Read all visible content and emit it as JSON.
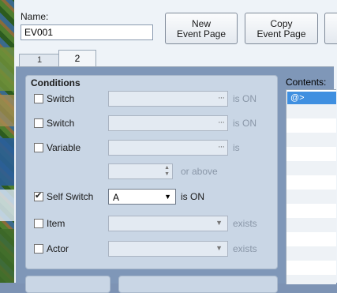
{
  "name": {
    "label": "Name:",
    "value": "EV001"
  },
  "buttons": {
    "new_event_page": "New\nEvent Page",
    "copy_event_page": "Copy\nEvent Page"
  },
  "tabs": [
    {
      "label": "1"
    },
    {
      "label": "2",
      "selected": true
    }
  ],
  "conditions": {
    "title": "Conditions",
    "rows": [
      {
        "label": "Switch",
        "checked": false,
        "value": "",
        "suffix": "is ON",
        "control": "picker"
      },
      {
        "label": "Switch",
        "checked": false,
        "value": "",
        "suffix": "is ON",
        "control": "picker"
      },
      {
        "label": "Variable",
        "checked": false,
        "value": "",
        "suffix": "is",
        "control": "picker"
      },
      {
        "label": "",
        "checked": null,
        "value": "",
        "suffix": "or above",
        "control": "spinner"
      },
      {
        "label": "Self Switch",
        "checked": true,
        "value": "A",
        "suffix": "is ON",
        "control": "select"
      },
      {
        "label": "Item",
        "checked": false,
        "value": "",
        "suffix": "exists",
        "control": "dropdown"
      },
      {
        "label": "Actor",
        "checked": false,
        "value": "",
        "suffix": "exists",
        "control": "dropdown"
      }
    ]
  },
  "contents": {
    "label": "Contents:",
    "items": [
      "@>"
    ]
  },
  "colors": {
    "panel": "#c9d6e5",
    "selection": "#3f8fe0",
    "background": "#7f97b8"
  }
}
